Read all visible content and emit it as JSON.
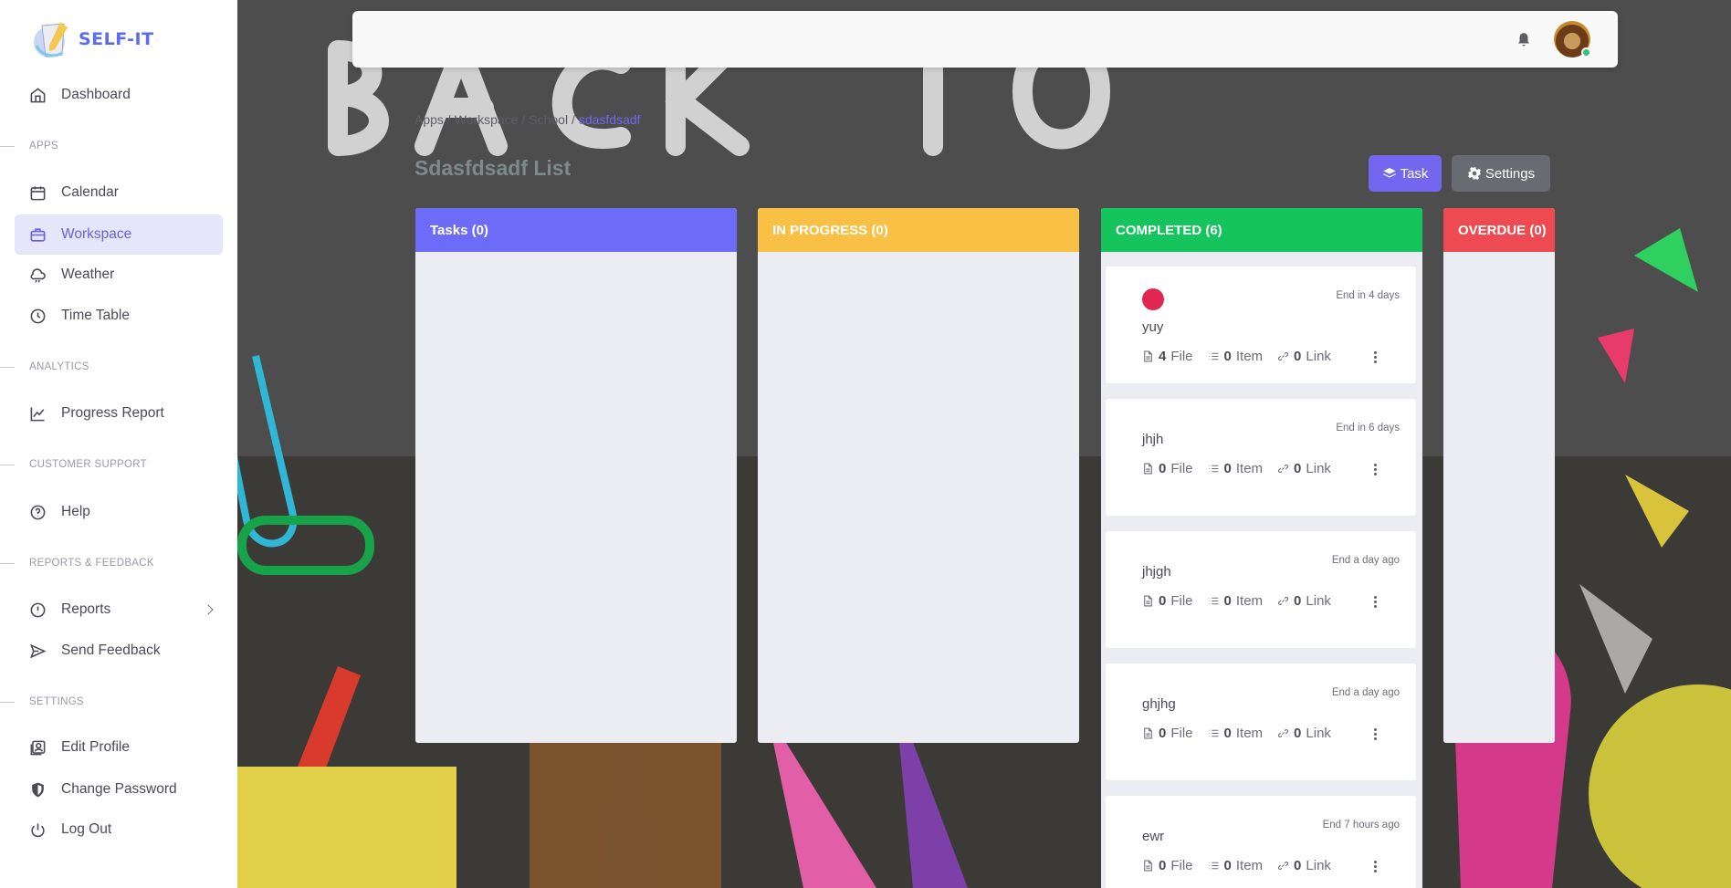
{
  "app": {
    "name": "SELF-IT"
  },
  "sidebar": {
    "items": [
      {
        "label": "Dashboard",
        "icon": "home-icon"
      },
      {
        "label": "Calendar",
        "icon": "calendar-icon"
      },
      {
        "label": "Workspace",
        "icon": "briefcase-icon",
        "active": true
      },
      {
        "label": "Weather",
        "icon": "cloud-icon"
      },
      {
        "label": "Time Table",
        "icon": "clock-icon"
      },
      {
        "label": "Progress Report",
        "icon": "trending-up-icon"
      },
      {
        "label": "Help",
        "icon": "help-circle-icon"
      },
      {
        "label": "Reports",
        "icon": "alert-circle-icon"
      },
      {
        "label": "Send Feedback",
        "icon": "send-icon"
      },
      {
        "label": "Edit Profile",
        "icon": "user-card-icon"
      },
      {
        "label": "Change Password",
        "icon": "shield-icon"
      },
      {
        "label": "Log Out",
        "icon": "power-icon"
      }
    ],
    "sections": {
      "apps": "APPS",
      "analytics": "ANALYTICS",
      "support": "CUSTOMER SUPPORT",
      "reports": "REPORTS & FEEDBACK",
      "settings": "SETTINGS"
    }
  },
  "breadcrumb": [
    "Apps /",
    "Workspace /",
    "School /",
    "sdasfdsadf"
  ],
  "page": {
    "title": "Sdasfdsadf List"
  },
  "buttons": {
    "task": "Task",
    "settings": "Settings"
  },
  "columns": {
    "tasks": "Tasks (0)",
    "in_progress": "IN PROGRESS (0)",
    "completed": "COMPLETED (6)",
    "overdue": "OVERDUE (0)"
  },
  "cards": [
    {
      "name": "yuy",
      "end": "End in 4 days",
      "files": "4",
      "items": "0",
      "links": "0",
      "dot_color": "#e0264e"
    },
    {
      "name": "jhjh",
      "end": "End in 6 days",
      "files": "0",
      "items": "0",
      "links": "0"
    },
    {
      "name": "jhjgh",
      "end": "End a day ago",
      "files": "0",
      "items": "0",
      "links": "0"
    },
    {
      "name": "ghjhg",
      "end": "End a day ago",
      "files": "0",
      "items": "0",
      "links": "0"
    },
    {
      "name": "ewr",
      "end": "End 7 hours ago",
      "files": "0",
      "items": "0",
      "links": "0"
    }
  ],
  "labels": {
    "file": "File",
    "item": "Item",
    "link": "Link"
  },
  "colors": {
    "accent": "#7367f0",
    "todo": "#6d6cf8",
    "progress": "#f8c146",
    "completed": "#16c45e",
    "overdue": "#ee4a52"
  }
}
